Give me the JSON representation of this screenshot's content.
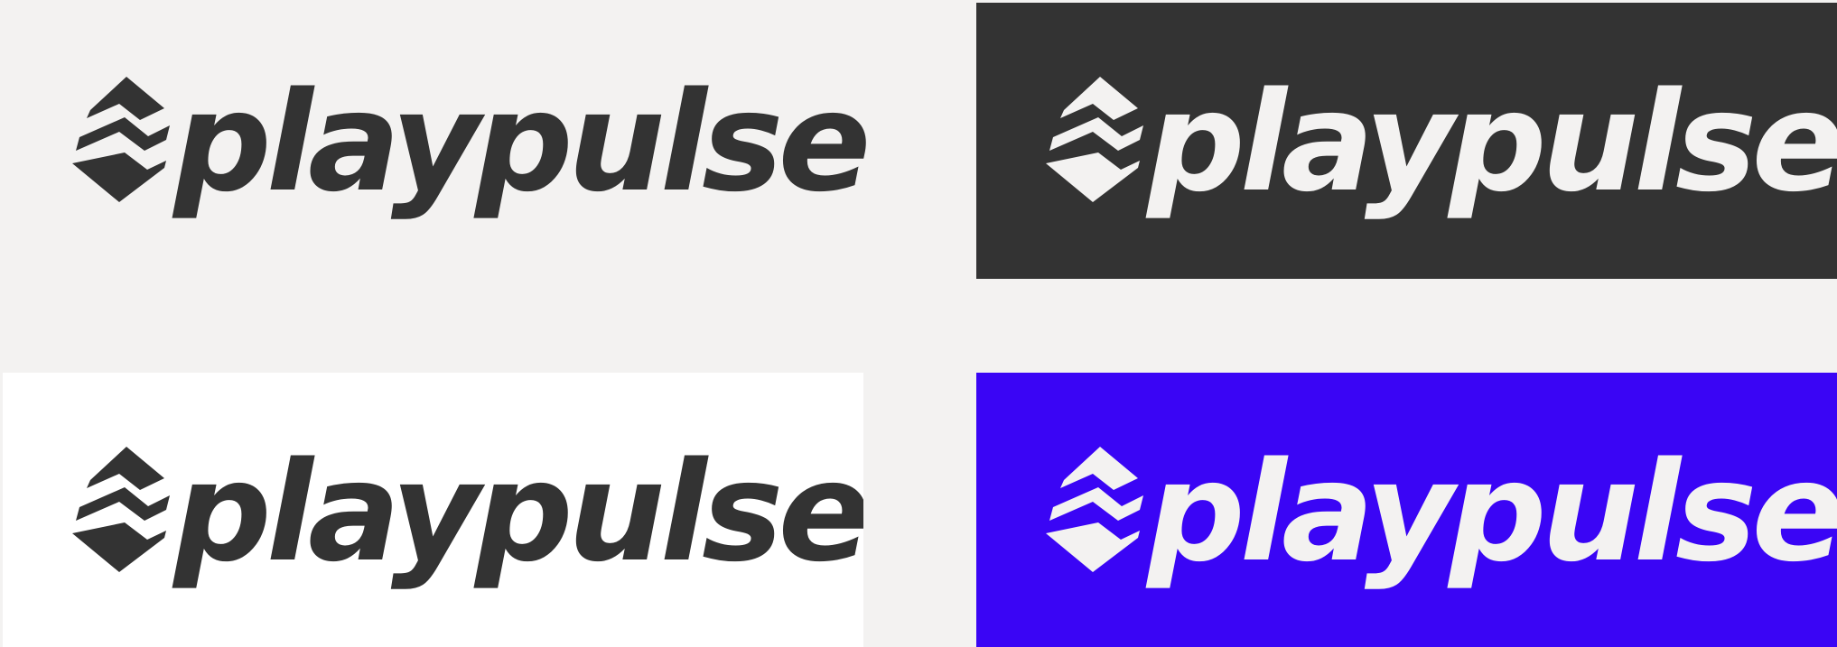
{
  "brand": {
    "wordmark": "playpulse"
  },
  "variants": [
    {
      "id": "light",
      "background": "#f3f2f1",
      "foreground": "#333333"
    },
    {
      "id": "dark",
      "background": "#333333",
      "foreground": "#f3f2f1"
    },
    {
      "id": "white",
      "background": "#ffffff",
      "foreground": "#333333"
    },
    {
      "id": "blue",
      "background": "#3a05f5",
      "foreground": "#f3f2f1"
    }
  ]
}
